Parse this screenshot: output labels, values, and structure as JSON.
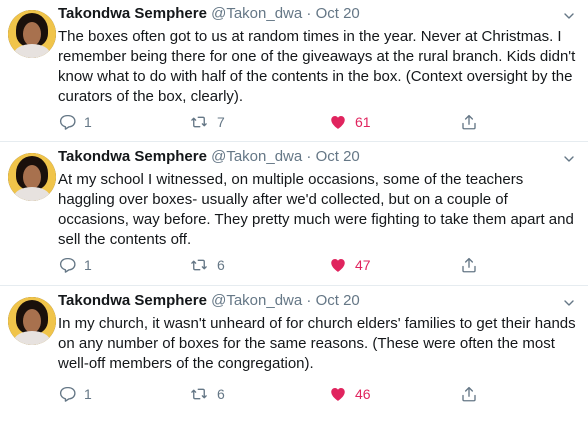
{
  "tweets": [
    {
      "name": "Takondwa Semphere",
      "handle": "@Takon_dwa",
      "separator": "·",
      "date": "Oct 20",
      "text": "The boxes often got to us at random times in the year. Never at Christmas. I remember being there for one of the giveaways at the rural branch. Kids didn't know what to do with half of the contents in the box. (Context oversight by the curators of the box, clearly).",
      "replies": "1",
      "retweets": "7",
      "likes": "61"
    },
    {
      "name": "Takondwa Semphere",
      "handle": "@Takon_dwa",
      "separator": "·",
      "date": "Oct 20",
      "text": "At my school I witnessed, on multiple occasions, some of the teachers haggling over boxes- usually after we'd collected, but on a couple of occasions, way before. They pretty much were fighting to take them apart and sell the contents off.",
      "replies": "1",
      "retweets": "6",
      "likes": "47"
    },
    {
      "name": "Takondwa Semphere",
      "handle": "@Takon_dwa",
      "separator": "·",
      "date": "Oct 20",
      "text": "In my church, it wasn't unheard of for church elders' families to get their hands on any number of boxes for the same reasons. (These were often the most well-off members of the congregation).",
      "replies": "1",
      "retweets": "6",
      "likes": "46"
    }
  ],
  "icons": {
    "reply": "reply-icon",
    "retweet": "retweet-icon",
    "like": "heart-icon",
    "share": "share-icon",
    "more": "chevron-down-icon"
  },
  "colors": {
    "text": "#14171a",
    "secondary": "#657786",
    "like": "#e0245e",
    "divider": "#e6ecf0"
  }
}
